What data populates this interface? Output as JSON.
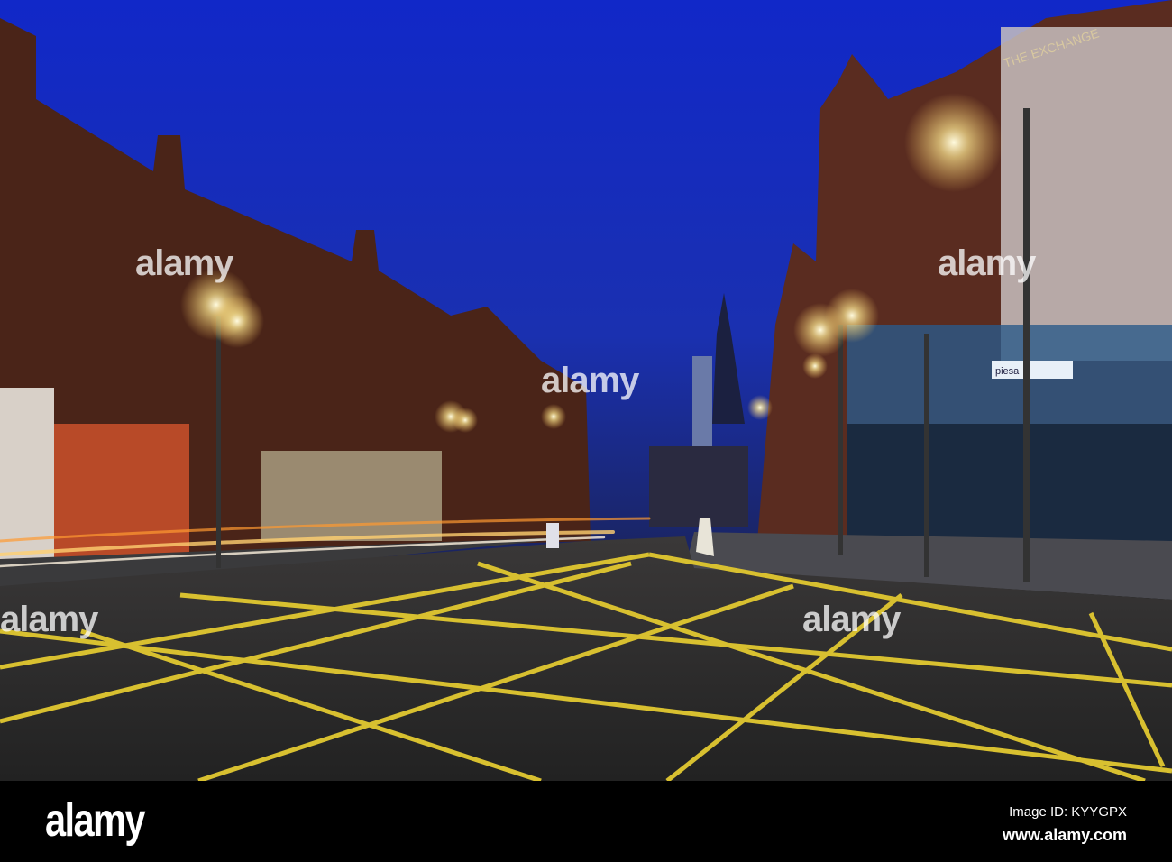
{
  "photo": {
    "signs": {
      "building": "THE EXCHANGE",
      "shop": "piesa"
    },
    "colors": {
      "sky_top": "#1a2fc8",
      "sky_bottom": "#1d2a7a",
      "road": "#2a2a2a",
      "road_lines": "#d8c030",
      "brick": "#5a2a1c",
      "light": "#fff6c8"
    }
  },
  "watermark": {
    "text": "alamy"
  },
  "footer": {
    "logo": "alamy",
    "image_id": "Image ID: KYYGPX",
    "website": "www.alamy.com"
  }
}
